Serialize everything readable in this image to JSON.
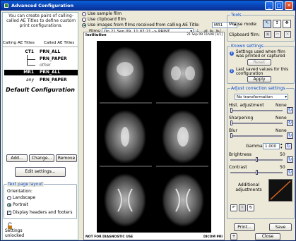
{
  "window": {
    "title": "Advanced Configuration",
    "minimize": "_",
    "maximize": "□",
    "close": "✕"
  },
  "left": {
    "intro": "You can create pairs of calling-called AE Titles to define custom print configurations.",
    "col_calling": "Calling AE Titles",
    "col_called": "Called AE Titles",
    "rules": [
      {
        "calling": "CT1",
        "called": "PRN_ALL"
      },
      {
        "calling": "",
        "called": "PRN_PAPER"
      },
      {
        "calling": "",
        "called": "other"
      },
      {
        "calling": "MR1",
        "called": "PRN_ALL"
      },
      {
        "calling": "any",
        "called": "PRN_PAPER"
      }
    ],
    "default_config": "Default Configuration",
    "add": "Add...",
    "change": "Change...",
    "remove": "Remove",
    "edit_settings": "Edit settings...",
    "text_layout_title": "Text page layout",
    "orientation": "Orientation:",
    "landscape": "Landscape",
    "portrait": "Portrait",
    "display_hf": "Display headers and footers",
    "settings_status": "Settings unlocked"
  },
  "center": {
    "opt_sample": "Use sample film",
    "opt_clipboard": "Use clipboard film",
    "opt_received": "Use images from films received from calling AE Title:",
    "ae_value": "MR1",
    "films_label": "Films:",
    "films_value": "On 21 Sep 09, 11:07:21 -> PRINT",
    "preview": {
      "institution": "Institution",
      "date": "21 Sep 09 11h08 [1/1]",
      "footer_left": "NOT FOR DIAGNOSTIC USE",
      "footer_right": "DICOM PRI"
    }
  },
  "right": {
    "tools_title": "Tools",
    "mouse_mode": "Mouse mode:",
    "clipboard_film": "Clipboard film:",
    "known_title": "Known settings",
    "known_text": "Settings used when film was printed or captured",
    "reset": "Reset",
    "last_saved": "Last saved values for this configuration",
    "apply": "Apply",
    "adjust_title": "Adjust correction settings",
    "transformation": "No transformation",
    "hist": "Hist. adjustment",
    "hist_val": "None",
    "sharpening": "Sharpening",
    "sharp_val": "None",
    "blur": "Blur",
    "blur_val": "None",
    "gamma": "Gamma",
    "gamma_val": "1.000",
    "brightness": "Brightness",
    "bright_val": "50",
    "contrast": "Contrast",
    "contrast_val": "50",
    "additional": "Additional adjustments",
    "print": "Print...",
    "save": "Save",
    "close": "Close",
    "plus": "+"
  },
  "levels": {
    "brightness": 0.5,
    "contrast": 0.5
  }
}
